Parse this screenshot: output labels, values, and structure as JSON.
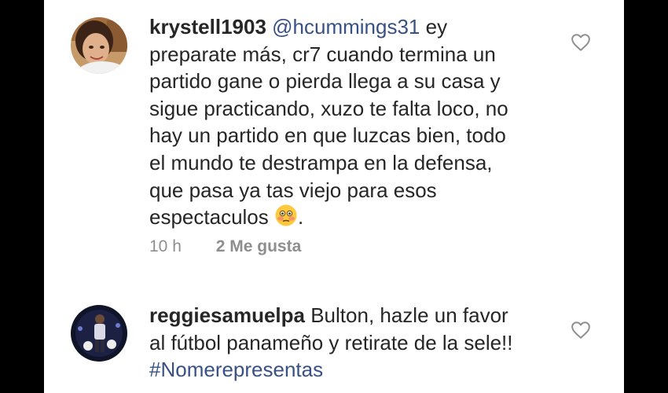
{
  "comments": [
    {
      "username": "krystell1903",
      "mention": "@hcummings31",
      "lines": [
        "ey",
        "preparate más, cr7 cuando termina un",
        "partido gane o pierda llega a su casa y",
        "sigue practicando, xuzo te falta loco, no",
        "hay un partido en que luzcas bien,  todo",
        "el mundo te destrampa en la defensa,",
        "que pasa ya tas viejo para esos",
        "espectaculos ",
        "."
      ],
      "broken_glyph": "",
      "emoji_icon": "flushed-face-emoji",
      "time": "10 h",
      "likes": "2 Me gusta"
    },
    {
      "username": "reggiesamuelpa",
      "lines": [
        "Bulton, hazle un favor",
        "al fútbol panameño y retirate de la sele!!"
      ],
      "hashtag": "#Nomerepresentas"
    }
  ],
  "colors": {
    "background": "#000000",
    "panel": "#ffffff",
    "text": "#262626",
    "link": "#385185",
    "meta": "#8e8e8e"
  },
  "icons": [
    "heart-outline-icon",
    "avatar-photo"
  ]
}
